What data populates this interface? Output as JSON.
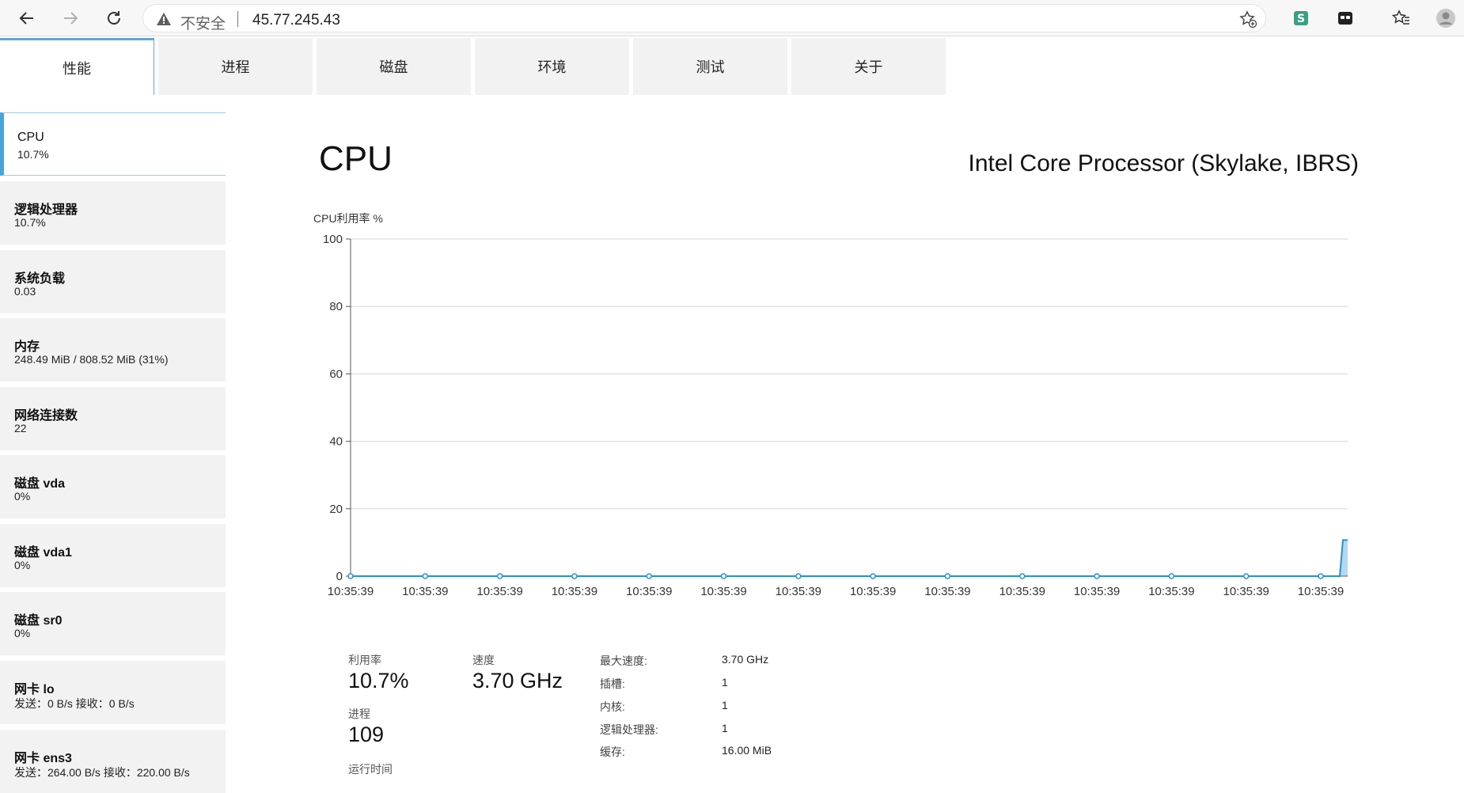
{
  "browser": {
    "security_label": "不安全",
    "url": "45.77.245.43"
  },
  "tabs": [
    "性能",
    "进程",
    "磁盘",
    "环境",
    "测试",
    "关于"
  ],
  "sidebar": [
    {
      "title": "CPU",
      "value": "10.7%"
    },
    {
      "title": "逻辑处理器",
      "value": "10.7%"
    },
    {
      "title": "系统负载",
      "value": "0.03"
    },
    {
      "title": "内存",
      "value": "248.49 MiB / 808.52 MiB (31%)"
    },
    {
      "title": "网络连接数",
      "value": "22"
    },
    {
      "title": "磁盘 vda",
      "value": "0%"
    },
    {
      "title": "磁盘 vda1",
      "value": "0%"
    },
    {
      "title": "磁盘 sr0",
      "value": "0%"
    },
    {
      "title": "网卡 lo",
      "value": "发送：0 B/s 接收：0 B/s"
    },
    {
      "title": "网卡 ens3",
      "value": "发送：264.00 B/s 接收：220.00 B/s"
    }
  ],
  "main": {
    "title": "CPU",
    "processor": "Intel Core Processor (Skylake, IBRS)"
  },
  "chart_data": {
    "type": "area",
    "ylabel": "CPU利用率 %",
    "ylim": [
      0,
      100
    ],
    "yticks": [
      0,
      20,
      40,
      60,
      80,
      100
    ],
    "x": [
      "10:35:39",
      "10:35:39",
      "10:35:39",
      "10:35:39",
      "10:35:39",
      "10:35:39",
      "10:35:39",
      "10:35:39",
      "10:35:39",
      "10:35:39",
      "10:35:39",
      "10:35:39",
      "10:35:39",
      "10:35:39",
      "10:35:39"
    ],
    "values": [
      0,
      0,
      0,
      0,
      0,
      0,
      0,
      0,
      0,
      0,
      0,
      0,
      0,
      0,
      10.7
    ],
    "grid": true,
    "color": "#2b8fd0"
  },
  "stats": {
    "usage_label": "利用率",
    "usage_value": "10.7%",
    "speed_label": "速度",
    "speed_value": "3.70 GHz",
    "process_label": "进程",
    "process_value": "109",
    "uptime_label": "运行时间",
    "details": [
      {
        "key": "最大速度:",
        "value": "3.70 GHz"
      },
      {
        "key": "插槽:",
        "value": "1"
      },
      {
        "key": "内核:",
        "value": "1"
      },
      {
        "key": "逻辑处理器:",
        "value": "1"
      },
      {
        "key": "缓存:",
        "value": "16.00 MiB"
      }
    ]
  }
}
